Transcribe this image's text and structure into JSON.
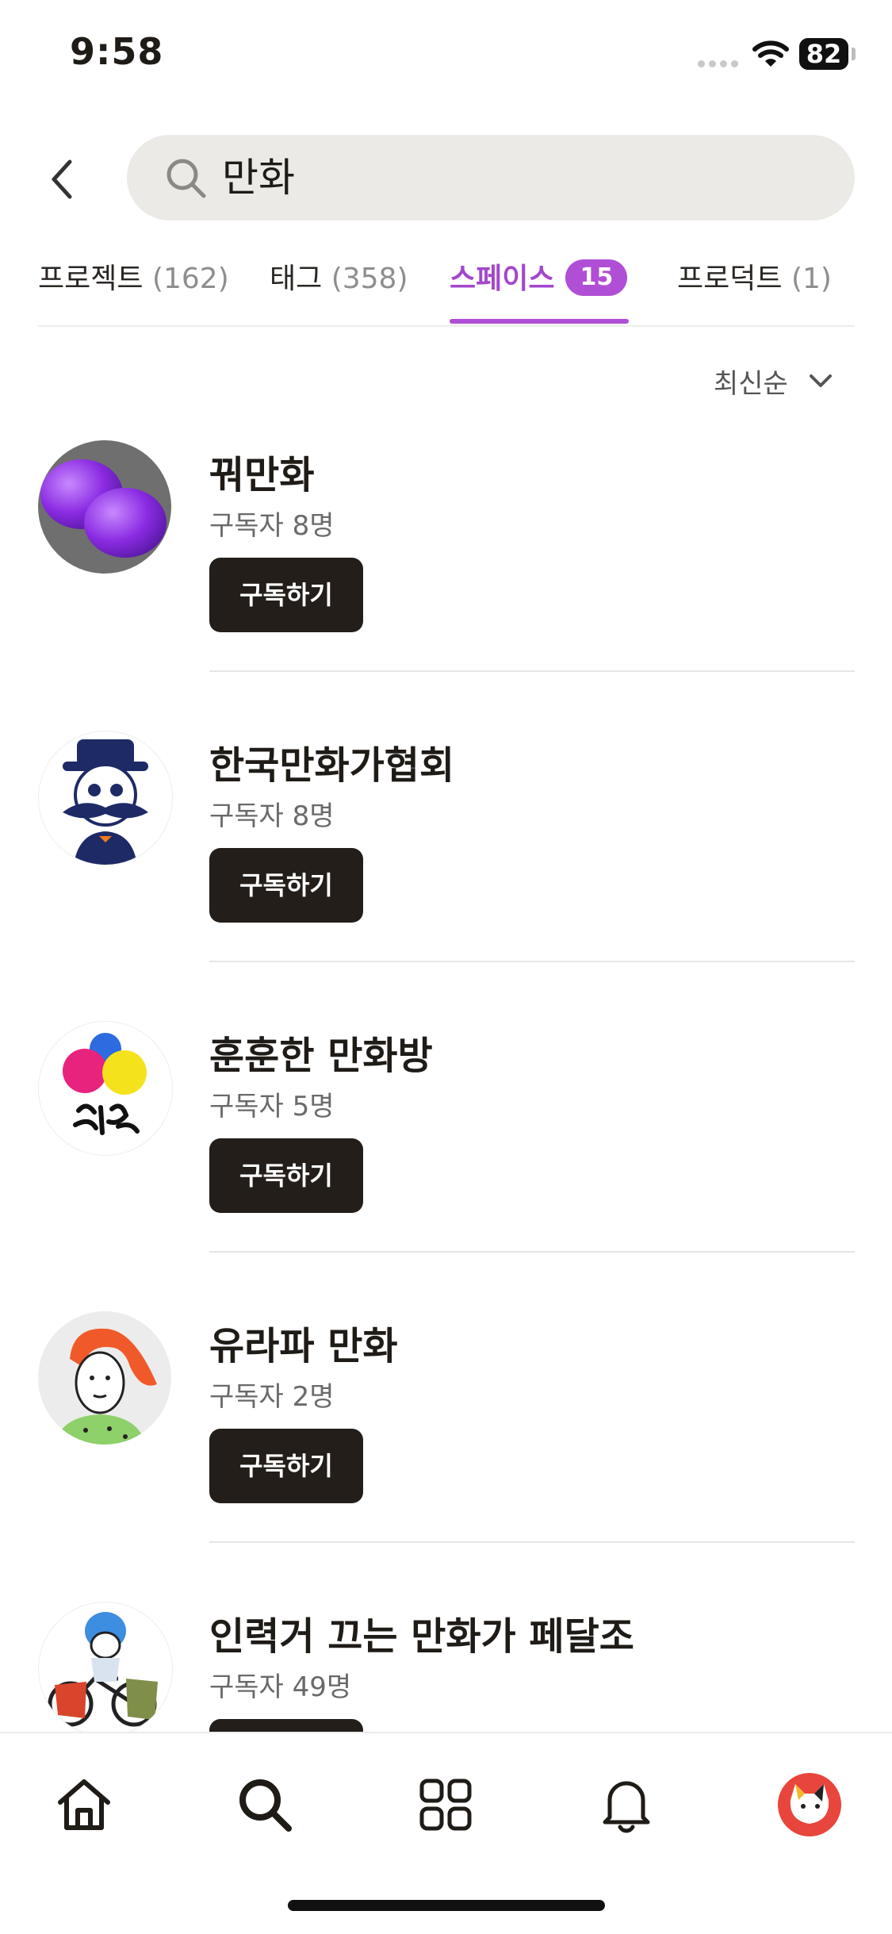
{
  "status": {
    "time": "9:58",
    "battery": "82"
  },
  "search": {
    "query": "만화"
  },
  "tabs": [
    {
      "label": "프로젝트",
      "count": "(162)"
    },
    {
      "label": "태그",
      "count": "(358)"
    },
    {
      "label": "스페이스",
      "badge": "15"
    },
    {
      "label": "프로덕트",
      "count": "(1)"
    }
  ],
  "sort": {
    "label": "최신순"
  },
  "spaces": [
    {
      "name": "꿔만화",
      "subscribers": "구독자 8명",
      "button": "구독하기"
    },
    {
      "name": "한국만화가협회",
      "subscribers": "구독자 8명",
      "button": "구독하기"
    },
    {
      "name": "훈훈한 만화방",
      "subscribers": "구독자 5명",
      "button": "구독하기"
    },
    {
      "name": "유라파 만화",
      "subscribers": "구독자 2명",
      "button": "구독하기"
    },
    {
      "name": "인력거 끄는 만화가 페달조",
      "subscribers": "구독자 49명",
      "button": "구독하기"
    }
  ],
  "nav": [
    "home-icon",
    "search-icon",
    "grid-icon",
    "bell-icon",
    "profile-avatar"
  ],
  "colors": {
    "accent": "#b04ed6",
    "button": "#231e19"
  }
}
